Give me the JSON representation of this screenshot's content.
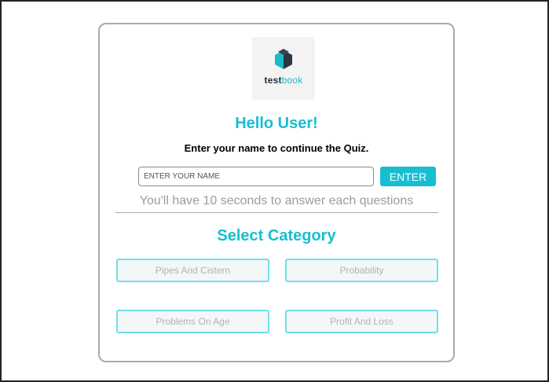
{
  "logo": {
    "text_part1": "test",
    "text_part2": "book",
    "colors": {
      "dark": "#1f2d3a",
      "accent": "#1cb9c8"
    }
  },
  "greeting": {
    "title": "Hello User!",
    "subtitle": "Enter your name to continue the Quiz."
  },
  "name_form": {
    "placeholder": "ENTER YOUR NAME",
    "value": "",
    "enter_label": "ENTER"
  },
  "hint": "You'll have 10 seconds to answer each questions",
  "category": {
    "title": "Select Category",
    "options": [
      "Pipes And Cistern",
      "Probability",
      "Problems On Age",
      "Profit And Loss"
    ]
  },
  "colors": {
    "accent": "#17bed0",
    "button_border": "#6fe0ea",
    "muted_text": "#9c9c9c"
  }
}
